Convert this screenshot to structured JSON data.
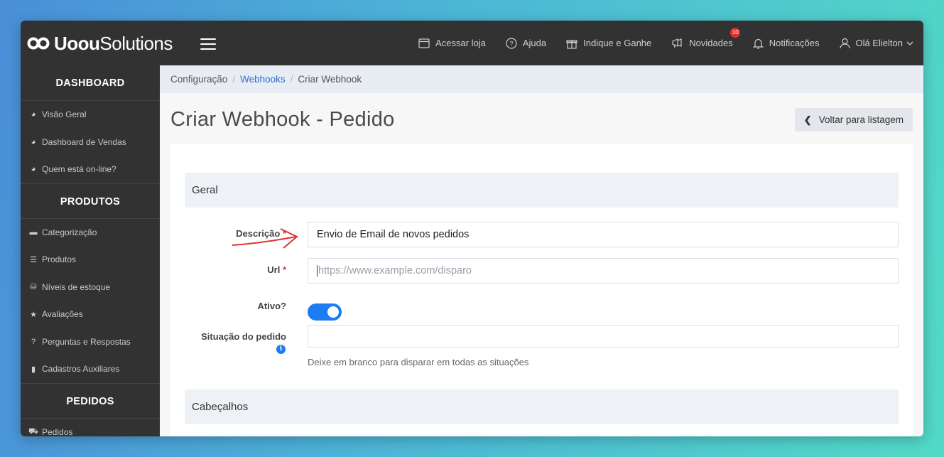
{
  "app": {
    "logo_bold": "Uoou",
    "logo_light": "Solutions"
  },
  "topnav": {
    "items": [
      {
        "label": "Acessar loja",
        "icon": "store-icon"
      },
      {
        "label": "Ajuda",
        "icon": "help-circle-icon"
      },
      {
        "label": "Indique e Ganhe",
        "icon": "gift-icon"
      },
      {
        "label": "Novidades",
        "icon": "megaphone-icon",
        "badge": "10"
      },
      {
        "label": "Notificações",
        "icon": "bell-icon"
      },
      {
        "label": "Olá Elielton",
        "icon": "user-icon"
      }
    ]
  },
  "sidebar": {
    "sections": [
      {
        "heading": "DASHBOARD",
        "items": [
          "Visão Geral",
          "Dashboard de Vendas",
          "Quem está on-line?"
        ]
      },
      {
        "heading": "PRODUTOS",
        "items": [
          "Categorização",
          "Produtos",
          "Níveis de estoque",
          "Avaliações",
          "Perguntas e Respostas",
          "Cadastros Auxiliares"
        ]
      },
      {
        "heading": "PEDIDOS",
        "items": [
          "Pedidos"
        ]
      }
    ]
  },
  "breadcrumb": {
    "items": [
      "Configuração",
      "Webhooks",
      "Criar Webhook"
    ]
  },
  "page": {
    "title": "Criar Webhook - Pedido",
    "back_label": "Voltar para listagem"
  },
  "form": {
    "section_general": "Geral",
    "section_headers": "Cabeçalhos",
    "descricao_label": "Descrição",
    "descricao_value": "Envio de Email de novos pedidos",
    "url_label": "Url",
    "url_placeholder": "https://www.example.com/disparo",
    "ativo_label": "Ativo?",
    "ativo_value": true,
    "situacao_label": "Situação do pedido",
    "situacao_value": "",
    "situacao_help": "Deixe em branco para disparar em todas as situações",
    "required_mark": "*"
  },
  "colors": {
    "accent": "#1d7cf2",
    "annotation_arrow": "#e0312f"
  }
}
